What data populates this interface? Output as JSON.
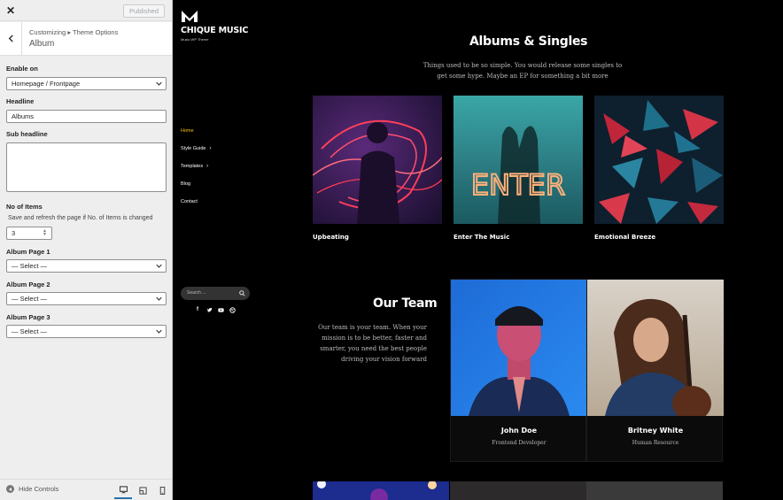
{
  "customizer": {
    "close_icon": "close-icon",
    "published_label": "Published",
    "breadcrumb": "Customizing ▸ Theme Options",
    "section_title": "Album",
    "fields": {
      "enable_on": {
        "label": "Enable on",
        "value": "Homepage / Frontpage"
      },
      "headline": {
        "label": "Headline",
        "value": "Albums"
      },
      "sub_headline": {
        "label": "Sub headline",
        "value": ""
      },
      "no_of_items": {
        "label": "No of Items",
        "description": "Save and refresh the page if No. of Items is changed",
        "value": "3"
      },
      "album_page_1": {
        "label": "Album Page 1",
        "value": "— Select —"
      },
      "album_page_2": {
        "label": "Album Page 2",
        "value": "— Select —"
      },
      "album_page_3": {
        "label": "Album Page 3",
        "value": "— Select —"
      }
    },
    "footer": {
      "hide_controls_label": "Hide Controls",
      "devices": [
        "desktop-icon",
        "tablet-icon",
        "mobile-icon"
      ],
      "active_device": "desktop",
      "accent_color": "#2271b1"
    }
  },
  "site": {
    "name": "CHIQUE MUSIC",
    "tagline": "Music WP Theme",
    "nav": [
      {
        "label": "Home",
        "current": true,
        "has_submenu": false
      },
      {
        "label": "Style Guide",
        "current": false,
        "has_submenu": true
      },
      {
        "label": "Templates",
        "current": false,
        "has_submenu": true
      },
      {
        "label": "Blog",
        "current": false,
        "has_submenu": false
      },
      {
        "label": "Contact",
        "current": false,
        "has_submenu": false
      }
    ],
    "nav_active_color": "#f5c518",
    "search_placeholder": "Search ...",
    "social_icons": [
      "facebook-icon",
      "twitter-icon",
      "youtube-icon",
      "dribbble-icon"
    ],
    "albums": {
      "title": "Albums & Singles",
      "intro_line1": "Things used to be so simple. You would release some singles to",
      "intro_line2": "get some hype. Maybe an EP for something a bit more",
      "items": [
        {
          "name": "Upbeating"
        },
        {
          "name": "Enter The Music",
          "image_text": "ENTER"
        },
        {
          "name": "Emotional Breeze"
        }
      ]
    },
    "team": {
      "title": "Our Team",
      "desc_lines": [
        "Our team is your team. When your",
        "mission is to be better, faster and",
        "smarter, you need the best people",
        "driving your vision forward"
      ],
      "members": [
        {
          "name": "John Doe",
          "role": "Frontend Developer"
        },
        {
          "name": "Britney White",
          "role": "Human Resource"
        }
      ]
    }
  }
}
